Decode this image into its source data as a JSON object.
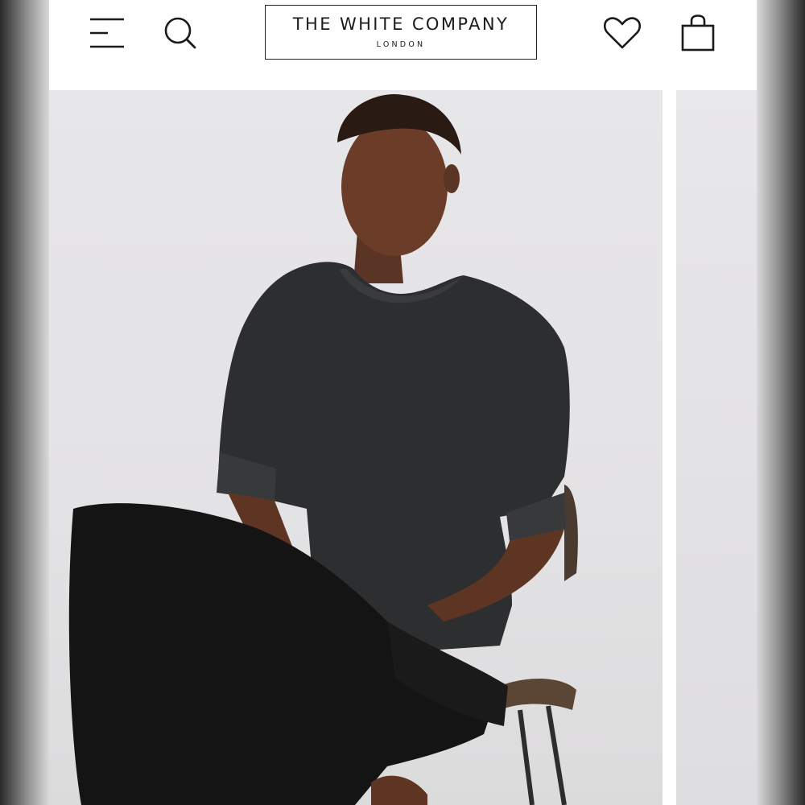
{
  "header": {
    "brand_name": "THE WHITE COMPANY",
    "brand_location": "LONDON",
    "icons": {
      "menu": "menu-icon",
      "search": "search-icon",
      "wishlist": "heart-icon",
      "bag": "shopping-bag-icon"
    }
  },
  "gallery": {
    "main_image": "product-photo-model-charcoal-knit-jumper",
    "next_image": "product-photo-next"
  },
  "colors": {
    "text": "#1b1b1b",
    "background": "#ffffff",
    "image_background": "#e4e3e5"
  }
}
